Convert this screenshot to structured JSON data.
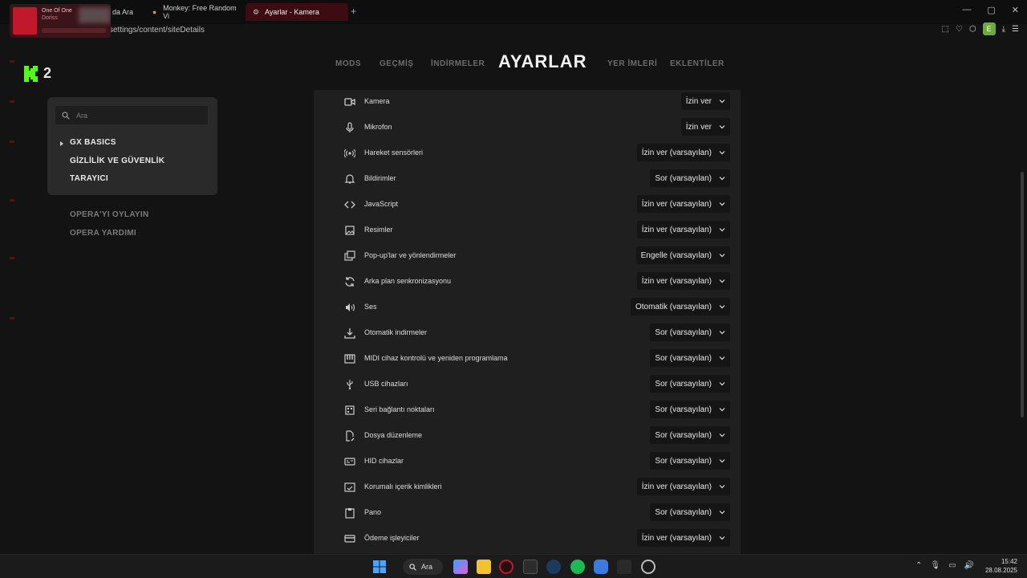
{
  "browser": {
    "media": {
      "title": "One Of One",
      "artist": "Doriss"
    },
    "tabs": [
      {
        "label": "da Ara"
      },
      {
        "label": "Monkey: Free Random Vi"
      },
      {
        "label": "Ayarlar - Kamera",
        "active": true
      }
    ],
    "new_tab": "+",
    "url": "settings/content/siteDetails",
    "profile_letter": "E",
    "window_controls": [
      "—",
      "▢",
      "✕"
    ]
  },
  "logo": {
    "number": "2"
  },
  "nav": {
    "items": [
      "MODS",
      "GEÇMİŞ",
      "İNDİRMELER",
      "YER İMLERİ",
      "EKLENTİLER"
    ],
    "title": "AYARLAR"
  },
  "sidebar": {
    "search_placeholder": "Ara",
    "items": [
      "GX BASICS",
      "GİZLİLİK VE GÜVENLİK",
      "TARAYICI"
    ],
    "links": [
      "OPERA'YI OYLAYIN",
      "OPERA YARDIMI"
    ]
  },
  "permissions": [
    {
      "icon": "camera-icon",
      "label": "Kamera",
      "value": "İzin ver"
    },
    {
      "icon": "microphone-icon",
      "label": "Mikrofon",
      "value": "İzin ver"
    },
    {
      "icon": "motion-sensor-icon",
      "label": "Hareket sensörleri",
      "value": "İzin ver (varsayılan)"
    },
    {
      "icon": "bell-icon",
      "label": "Bildirimler",
      "value": "Sor (varsayılan)"
    },
    {
      "icon": "code-icon",
      "label": "JavaScript",
      "value": "İzin ver (varsayılan)"
    },
    {
      "icon": "image-icon",
      "label": "Resimler",
      "value": "İzin ver (varsayılan)"
    },
    {
      "icon": "popup-icon",
      "label": "Pop-up'lar ve yönlendirmeler",
      "value": "Engelle (varsayılan)"
    },
    {
      "icon": "sync-icon",
      "label": "Arka plan senkronizasyonu",
      "value": "İzin ver (varsayılan)"
    },
    {
      "icon": "sound-icon",
      "label": "Ses",
      "value": "Otomatik (varsayılan)"
    },
    {
      "icon": "download-icon",
      "label": "Otomatik indirmeler",
      "value": "Sor (varsayılan)"
    },
    {
      "icon": "midi-icon",
      "label": "MIDI cihaz kontrolü ve yeniden programlama",
      "value": "Sor (varsayılan)"
    },
    {
      "icon": "usb-icon",
      "label": "USB cihazları",
      "value": "Sor (varsayılan)"
    },
    {
      "icon": "serial-port-icon",
      "label": "Seri bağlantı noktaları",
      "value": "Sor (varsayılan)"
    },
    {
      "icon": "file-edit-icon",
      "label": "Dosya düzenleme",
      "value": "Sor (varsayılan)"
    },
    {
      "icon": "hid-icon",
      "label": "HID cihazlar",
      "value": "Sor (varsayılan)"
    },
    {
      "icon": "protected-content-icon",
      "label": "Korumalı içerik kimlikleri",
      "value": "İzin ver (varsayılan)"
    },
    {
      "icon": "clipboard-icon",
      "label": "Pano",
      "value": "Sor (varsayılan)"
    },
    {
      "icon": "payment-icon",
      "label": "Ödeme işleyiciler",
      "value": "İzin ver (varsayılan)"
    }
  ],
  "taskbar": {
    "search_label": "Ara",
    "time": "15:42",
    "date": "28.08.2025"
  },
  "colors": {
    "accent_red": "#c2182b",
    "panel_bg": "#1f1f1f",
    "sidebar_bg": "#2a2a2a",
    "dropdown_bg": "#151515"
  }
}
